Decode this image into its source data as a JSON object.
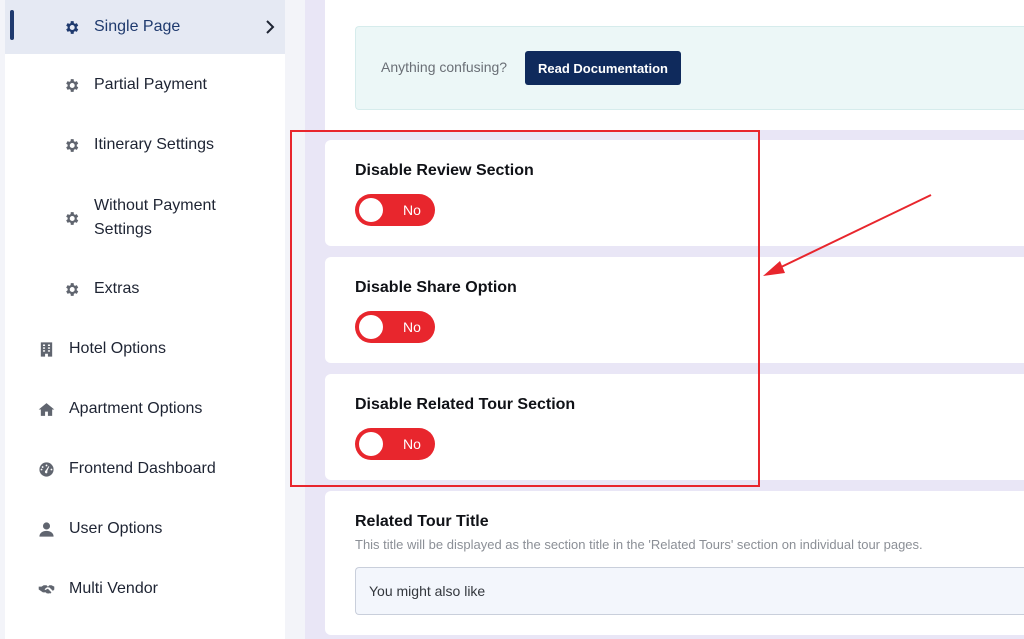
{
  "sidebar": {
    "items": [
      {
        "label": "Single Page",
        "icon": "gear-icon",
        "active": true
      },
      {
        "label": "Partial Payment",
        "icon": "gear-icon"
      },
      {
        "label": "Itinerary Settings",
        "icon": "gear-icon"
      },
      {
        "label_lines": [
          "Without Payment",
          "Settings"
        ],
        "icon": "gear-icon"
      },
      {
        "label": "Extras",
        "icon": "gear-icon"
      },
      {
        "label": "Hotel Options",
        "icon": "building-icon"
      },
      {
        "label": "Apartment Options",
        "icon": "home-icon"
      },
      {
        "label": "Frontend Dashboard",
        "icon": "dashboard-icon"
      },
      {
        "label": "User Options",
        "icon": "user-icon"
      },
      {
        "label": "Multi Vendor",
        "icon": "handshake-icon"
      }
    ]
  },
  "notice": {
    "text": "Anything confusing?",
    "button_label": "Read Documentation"
  },
  "settings": [
    {
      "title": "Disable Review Section",
      "toggle_text": "No"
    },
    {
      "title": "Disable Share Option",
      "toggle_text": "No"
    },
    {
      "title": "Disable Related Tour Section",
      "toggle_text": "No"
    }
  ],
  "related_title": {
    "label": "Related Tour Title",
    "description": "This title will be displayed as the section title in the 'Related Tours' section on individual tour pages.",
    "value": "You might also like"
  },
  "colors": {
    "accent_red": "#e8262d",
    "navy": "#0f2a5c",
    "active_nav": "#1f3a6e"
  }
}
